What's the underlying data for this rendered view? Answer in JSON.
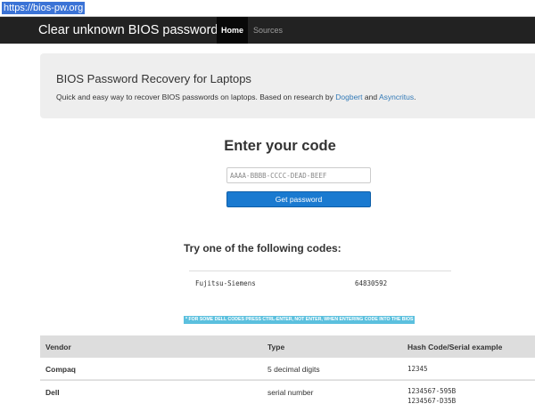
{
  "browser": {
    "url": "https://bios-pw.org"
  },
  "navbar": {
    "brand": "Clear unknown BIOS passwords",
    "home": "Home",
    "sources": "Sources"
  },
  "jumbotron": {
    "title": "BIOS Password Recovery for Laptops",
    "desc_prefix": "Quick and easy way to recover BIOS passwords on laptops. Based on research by ",
    "link1": "Dogbert",
    "desc_mid": " and ",
    "link2": "Asyncritus",
    "desc_suffix": "."
  },
  "form": {
    "title": "Enter your code",
    "placeholder": "AAAA-BBBB-CCCC-DEAD-BEEF",
    "button": "Get password"
  },
  "samples": {
    "title": "Try one of the following codes:",
    "rows": [
      {
        "vendor": "Fujitsu-Siemens",
        "code": "64830592"
      }
    ]
  },
  "notice": "* FOR SOME DELL CODES PRESS CTRL-ENTER, NOT ENTER, WHEN ENTERING CODE INTO THE BIOS",
  "vendor_table": {
    "headers": [
      "Vendor",
      "Type",
      "Hash Code/Serial example"
    ],
    "rows": [
      {
        "vendor": "Compaq",
        "type": "5 decimal digits",
        "examples": [
          "12345"
        ]
      },
      {
        "vendor": "Dell",
        "type": "serial number",
        "examples": [
          "1234567-595B",
          "1234567-D35B"
        ]
      }
    ]
  },
  "colors": {
    "navbar": "#222222",
    "accent": "#337ab7",
    "button": "#1a7ad0",
    "notice": "#5bc0de"
  }
}
